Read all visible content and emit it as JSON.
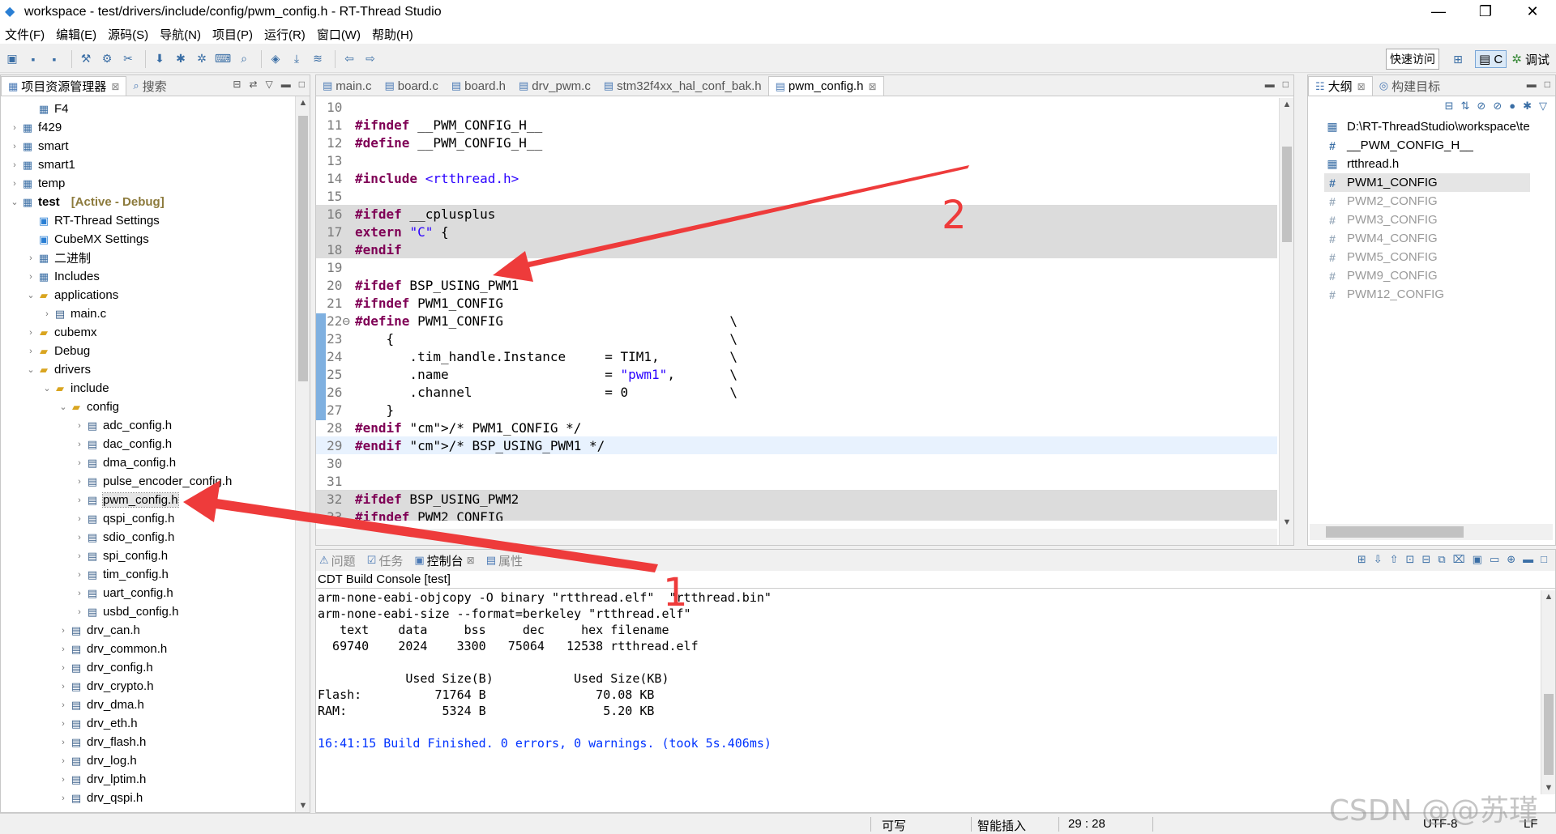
{
  "window": {
    "title": "workspace - test/drivers/include/config/pwm_config.h - RT-Thread Studio",
    "min": "—",
    "max": "❐",
    "close": "✕"
  },
  "menu": [
    "文件(F)",
    "编辑(E)",
    "源码(S)",
    "导航(N)",
    "项目(P)",
    "运行(R)",
    "窗口(W)",
    "帮助(H)"
  ],
  "toolbar": {
    "quick_access": "快速访问",
    "perspective_c": "C",
    "perspective_debug": "调试"
  },
  "explorer": {
    "tabs": [
      {
        "label": "项目资源管理器",
        "close": "⊠"
      },
      {
        "label": "搜索"
      }
    ],
    "items": [
      {
        "label": "F4",
        "indent": 1,
        "twisty": "",
        "icon": "proj"
      },
      {
        "label": "f429",
        "indent": 0,
        "twisty": "›",
        "icon": "proj"
      },
      {
        "label": "smart",
        "indent": 0,
        "twisty": "›",
        "icon": "proj"
      },
      {
        "label": "smart1",
        "indent": 0,
        "twisty": "›",
        "icon": "proj"
      },
      {
        "label": "temp",
        "indent": 0,
        "twisty": "›",
        "icon": "proj"
      },
      {
        "label": "test",
        "indent": 0,
        "twisty": "⌄",
        "icon": "proj",
        "tag": "[Active - Debug]",
        "bold": true
      },
      {
        "label": "RT-Thread Settings",
        "indent": 1,
        "twisty": "",
        "icon": "set"
      },
      {
        "label": "CubeMX Settings",
        "indent": 1,
        "twisty": "",
        "icon": "set"
      },
      {
        "label": "二进制",
        "indent": 1,
        "twisty": "›",
        "icon": "proj"
      },
      {
        "label": "Includes",
        "indent": 1,
        "twisty": "›",
        "icon": "proj"
      },
      {
        "label": "applications",
        "indent": 1,
        "twisty": "⌄",
        "icon": "folder"
      },
      {
        "label": "main.c",
        "indent": 2,
        "twisty": "›",
        "icon": "file"
      },
      {
        "label": "cubemx",
        "indent": 1,
        "twisty": "›",
        "icon": "folder"
      },
      {
        "label": "Debug",
        "indent": 1,
        "twisty": "›",
        "icon": "folder"
      },
      {
        "label": "drivers",
        "indent": 1,
        "twisty": "⌄",
        "icon": "folder"
      },
      {
        "label": "include",
        "indent": 2,
        "twisty": "⌄",
        "icon": "folder"
      },
      {
        "label": "config",
        "indent": 3,
        "twisty": "⌄",
        "icon": "folder"
      },
      {
        "label": "adc_config.h",
        "indent": 4,
        "twisty": "›",
        "icon": "file"
      },
      {
        "label": "dac_config.h",
        "indent": 4,
        "twisty": "›",
        "icon": "file"
      },
      {
        "label": "dma_config.h",
        "indent": 4,
        "twisty": "›",
        "icon": "file"
      },
      {
        "label": "pulse_encoder_config.h",
        "indent": 4,
        "twisty": "›",
        "icon": "file"
      },
      {
        "label": "pwm_config.h",
        "indent": 4,
        "twisty": "›",
        "icon": "file",
        "selected": true
      },
      {
        "label": "qspi_config.h",
        "indent": 4,
        "twisty": "›",
        "icon": "file"
      },
      {
        "label": "sdio_config.h",
        "indent": 4,
        "twisty": "›",
        "icon": "file"
      },
      {
        "label": "spi_config.h",
        "indent": 4,
        "twisty": "›",
        "icon": "file"
      },
      {
        "label": "tim_config.h",
        "indent": 4,
        "twisty": "›",
        "icon": "file"
      },
      {
        "label": "uart_config.h",
        "indent": 4,
        "twisty": "›",
        "icon": "file"
      },
      {
        "label": "usbd_config.h",
        "indent": 4,
        "twisty": "›",
        "icon": "file"
      },
      {
        "label": "drv_can.h",
        "indent": 3,
        "twisty": "›",
        "icon": "file"
      },
      {
        "label": "drv_common.h",
        "indent": 3,
        "twisty": "›",
        "icon": "file"
      },
      {
        "label": "drv_config.h",
        "indent": 3,
        "twisty": "›",
        "icon": "file"
      },
      {
        "label": "drv_crypto.h",
        "indent": 3,
        "twisty": "›",
        "icon": "file"
      },
      {
        "label": "drv_dma.h",
        "indent": 3,
        "twisty": "›",
        "icon": "file"
      },
      {
        "label": "drv_eth.h",
        "indent": 3,
        "twisty": "›",
        "icon": "file"
      },
      {
        "label": "drv_flash.h",
        "indent": 3,
        "twisty": "›",
        "icon": "file"
      },
      {
        "label": "drv_log.h",
        "indent": 3,
        "twisty": "›",
        "icon": "file"
      },
      {
        "label": "drv_lptim.h",
        "indent": 3,
        "twisty": "›",
        "icon": "file"
      },
      {
        "label": "drv_qspi.h",
        "indent": 3,
        "twisty": "›",
        "icon": "file"
      }
    ]
  },
  "editor": {
    "tabs": [
      {
        "label": "main.c"
      },
      {
        "label": "board.c"
      },
      {
        "label": "board.h"
      },
      {
        "label": "drv_pwm.c"
      },
      {
        "label": "stm32f4xx_hal_conf_bak.h"
      },
      {
        "label": "pwm_config.h",
        "active": true,
        "close": "⊠"
      }
    ],
    "lines": [
      {
        "n": "10",
        "t": ""
      },
      {
        "n": "11",
        "t": "#ifndef __PWM_CONFIG_H__"
      },
      {
        "n": "12",
        "t": "#define __PWM_CONFIG_H__"
      },
      {
        "n": "13",
        "t": ""
      },
      {
        "n": "14",
        "t": "#include <rtthread.h>"
      },
      {
        "n": "15",
        "t": ""
      },
      {
        "n": "16",
        "t": "#ifdef __cplusplus",
        "shade": true
      },
      {
        "n": "17",
        "t": "extern \"C\" {",
        "shade": true
      },
      {
        "n": "18",
        "t": "#endif",
        "shade": true
      },
      {
        "n": "19",
        "t": ""
      },
      {
        "n": "20",
        "t": "#ifdef BSP_USING_PWM1"
      },
      {
        "n": "21",
        "t": "#ifndef PWM1_CONFIG"
      },
      {
        "n": "22",
        "t": "#define PWM1_CONFIG                             \\",
        "mark": true,
        "fold": "⊖"
      },
      {
        "n": "23",
        "t": "    {                                           \\",
        "mark": true
      },
      {
        "n": "24",
        "t": "       .tim_handle.Instance     = TIM1,         \\",
        "mark": true
      },
      {
        "n": "25",
        "t": "       .name                    = \"pwm1\",       \\",
        "mark": true
      },
      {
        "n": "26",
        "t": "       .channel                 = 0             \\",
        "mark": true
      },
      {
        "n": "27",
        "t": "    }",
        "mark": true
      },
      {
        "n": "28",
        "t": "#endif /* PWM1_CONFIG */"
      },
      {
        "n": "29",
        "t": "#endif /* BSP_USING_PWM1 */",
        "cur": true
      },
      {
        "n": "30",
        "t": ""
      },
      {
        "n": "31",
        "t": ""
      },
      {
        "n": "32",
        "t": "#ifdef BSP_USING_PWM2",
        "shade": true
      },
      {
        "n": "33",
        "t": "#ifndef PWM2_CONFIG",
        "shade": true
      }
    ]
  },
  "outline": {
    "tabs": [
      {
        "label": "大纲",
        "close": "⊠"
      },
      {
        "label": "构建目标"
      }
    ],
    "items": [
      {
        "label": "D:\\RT-ThreadStudio\\workspace\\te",
        "icon": "▦"
      },
      {
        "label": "__PWM_CONFIG_H__",
        "icon": "#"
      },
      {
        "label": "rtthread.h",
        "icon": "▦"
      },
      {
        "label": "PWM1_CONFIG",
        "icon": "#",
        "selected": true
      },
      {
        "label": "PWM2_CONFIG",
        "icon": "#",
        "dim": true
      },
      {
        "label": "PWM3_CONFIG",
        "icon": "#",
        "dim": true
      },
      {
        "label": "PWM4_CONFIG",
        "icon": "#",
        "dim": true
      },
      {
        "label": "PWM5_CONFIG",
        "icon": "#",
        "dim": true
      },
      {
        "label": "PWM9_CONFIG",
        "icon": "#",
        "dim": true
      },
      {
        "label": "PWM12_CONFIG",
        "icon": "#",
        "dim": true
      }
    ]
  },
  "console": {
    "tabs": [
      {
        "label": "问题",
        "icon": "⚠"
      },
      {
        "label": "任务",
        "icon": "☑"
      },
      {
        "label": "控制台",
        "icon": "▣",
        "active": true,
        "close": "⊠"
      },
      {
        "label": "属性",
        "icon": "▤"
      }
    ],
    "title": "CDT Build Console [test]",
    "lines": [
      {
        "t": "arm-none-eabi-objcopy -O binary \"rtthread.elf\"  \"rtthread.bin\""
      },
      {
        "t": "arm-none-eabi-size --format=berkeley \"rtthread.elf\""
      },
      {
        "t": "   text    data     bss     dec     hex filename"
      },
      {
        "t": "  69740    2024    3300   75064   12538 rtthread.elf"
      },
      {
        "t": ""
      },
      {
        "t": "            Used Size(B)           Used Size(KB)"
      },
      {
        "t": "Flash:          71764 B               70.08 KB"
      },
      {
        "t": "RAM:             5324 B                5.20 KB"
      },
      {
        "t": ""
      },
      {
        "t": "16:41:15 Build Finished. 0 errors, 0 warnings. (took 5s.406ms)",
        "blue": true
      }
    ]
  },
  "status": {
    "writable": "可写",
    "insert": "智能插入",
    "position": "29 : 28",
    "encoding": "UTF-8",
    "eol": "LF"
  },
  "annotations": {
    "one": "1",
    "two": "2",
    "color": "#ee3b3b"
  },
  "watermark": "CSDN @@苏瑾"
}
